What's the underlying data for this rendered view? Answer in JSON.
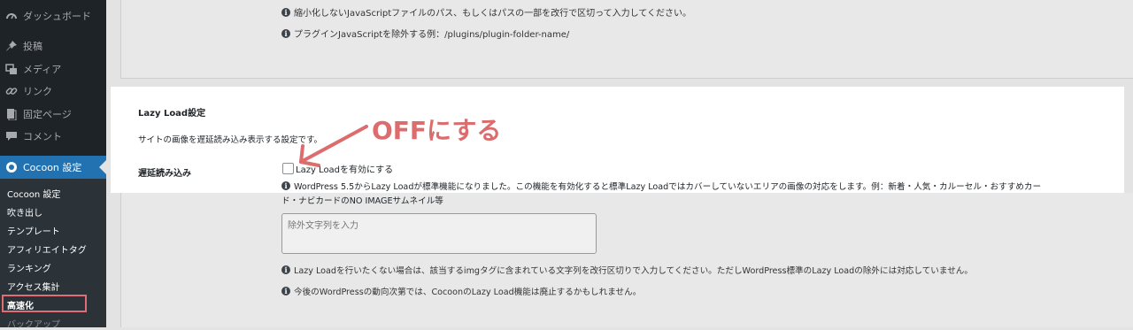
{
  "sidebar": {
    "items": [
      {
        "label": "ダッシュボード",
        "icon": "dashboard-icon"
      },
      {
        "label": "投稿",
        "icon": "pin-icon"
      },
      {
        "label": "メディア",
        "icon": "media-icon"
      },
      {
        "label": "リンク",
        "icon": "link-icon"
      },
      {
        "label": "固定ページ",
        "icon": "page-icon"
      },
      {
        "label": "コメント",
        "icon": "comment-icon"
      },
      {
        "label": "Cocoon 設定",
        "icon": "cocoon-icon"
      }
    ],
    "submenu": [
      {
        "label": "Cocoon 設定"
      },
      {
        "label": "吹き出し"
      },
      {
        "label": "テンプレート"
      },
      {
        "label": "アフィリエイトタグ"
      },
      {
        "label": "ランキング"
      },
      {
        "label": "アクセス集計"
      },
      {
        "label": "高速化"
      },
      {
        "label": "バックアップ"
      }
    ]
  },
  "top_notes": [
    "縮小化しないJavaScriptファイルのパス、もしくはパスの一部を改行で区切って入力してください。",
    "プラグインJavaScriptを除外する例：/plugins/plugin-folder-name/"
  ],
  "lazy": {
    "heading": "Lazy Load設定",
    "description": "サイトの画像を遅延読み込み表示する設定です。",
    "field_label": "遅延読み込み",
    "checkbox_label": "Lazy Loadを有効にする",
    "checkbox_checked": false,
    "info_line1": "WordPress 5.5からLazy Loadが標準機能になりました。この機能を有効化すると標準Lazy Loadではカバーしていないエリアの画像の対応をします。例：新着・人気・カルーセル・おすすめカー",
    "info_line2": "ド・ナビカードのNO IMAGEサムネイル等",
    "textarea_placeholder": "除外文字列を入力",
    "note1": "Lazy Loadを行いたくない場合は、該当するimgタグに含まれている文字列を改行区切りで入力してください。ただしWordPress標準のLazy Loadの除外には対応していません。",
    "note2": "今後のWordPressの動向次第では、CocoonのLazy Load機能は廃止するかもしれません。"
  },
  "annotation": {
    "text": "OFFにする",
    "color": "#dc6c6e"
  },
  "colors": {
    "sidebar_bg": "#1d2327",
    "accent": "#2271b1",
    "highlight": "#e06c75"
  }
}
